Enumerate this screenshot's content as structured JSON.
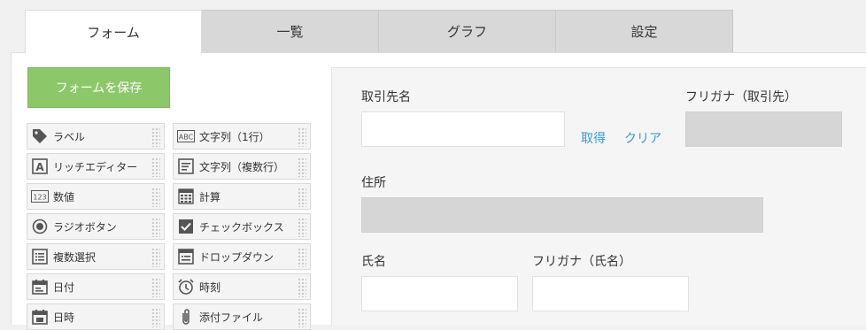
{
  "tabs": [
    {
      "label": "フォーム"
    },
    {
      "label": "一覧"
    },
    {
      "label": "グラフ"
    },
    {
      "label": "設定"
    }
  ],
  "save_button": "フォームを保存",
  "palette": [
    {
      "label": "ラベル",
      "icon": "tag-icon"
    },
    {
      "label": "文字列（1行）",
      "icon": "abc-text-icon"
    },
    {
      "label": "リッチエディター",
      "icon": "rich-editor-icon"
    },
    {
      "label": "文字列（複数行）",
      "icon": "multiline-text-icon"
    },
    {
      "label": "数値",
      "icon": "number-icon"
    },
    {
      "label": "計算",
      "icon": "calculator-icon"
    },
    {
      "label": "ラジオボタン",
      "icon": "radio-icon"
    },
    {
      "label": "チェックボックス",
      "icon": "checkbox-icon"
    },
    {
      "label": "複数選択",
      "icon": "multi-select-icon"
    },
    {
      "label": "ドロップダウン",
      "icon": "dropdown-icon"
    },
    {
      "label": "日付",
      "icon": "calendar-icon"
    },
    {
      "label": "時刻",
      "icon": "clock-icon"
    },
    {
      "label": "日時",
      "icon": "datetime-icon"
    },
    {
      "label": "添付ファイル",
      "icon": "paperclip-icon"
    }
  ],
  "form": {
    "client_name_label": "取引先名",
    "client_name_value": "",
    "fetch_link": "取得",
    "clear_link": "クリア",
    "client_furigana_label": "フリガナ（取引先）",
    "address_label": "住所",
    "person_name_label": "氏名",
    "person_name_value": "",
    "person_furigana_label": "フリガナ（氏名）",
    "person_furigana_value": ""
  },
  "colors": {
    "save_button": "#8cc86a",
    "link": "#3498db",
    "readonly_field": "#d6d6d6"
  }
}
